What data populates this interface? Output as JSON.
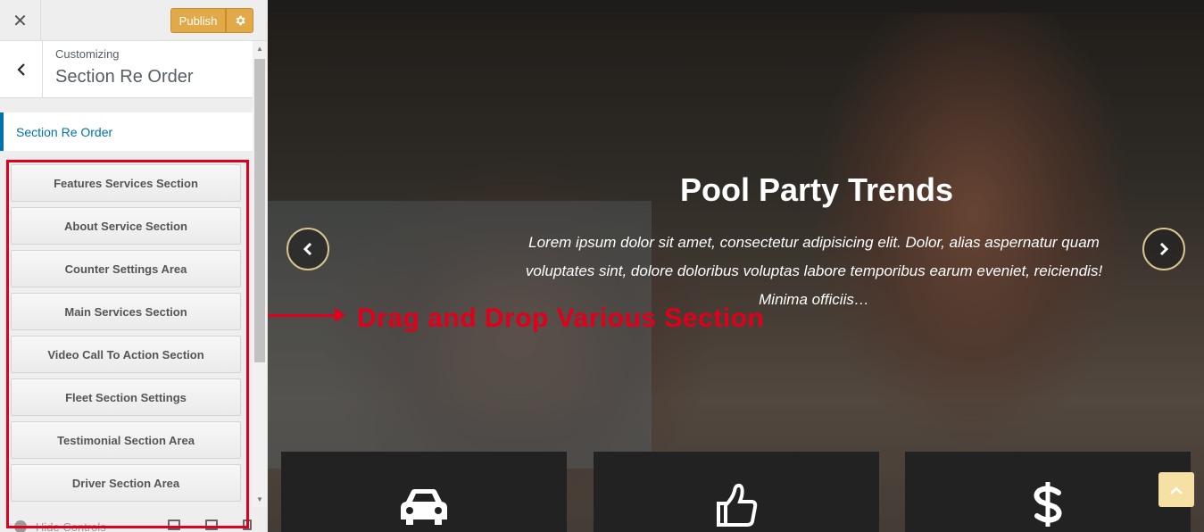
{
  "topbar": {
    "close_label": "✕",
    "publish_label": "Publish"
  },
  "panel": {
    "customizing_label": "Customizing",
    "title": "Section Re Order",
    "tab_label": "Section Re Order"
  },
  "sections": [
    "Features Services Section",
    "About Service Section",
    "Counter Settings Area",
    "Main Services Section",
    "Video Call To Action Section",
    "Fleet Section Settings",
    "Testimonial Section Area",
    "Driver Section Area"
  ],
  "footer": {
    "hide_controls_label": "Hide Controls"
  },
  "hero": {
    "title": "Pool Party Trends",
    "text": "Lorem ipsum dolor sit amet, consectetur adipisicing elit. Dolor, alias aspernatur quam voluptates sint, dolore doloribus voluptas labore temporibus earum eveniet, reiciendis! Minima officiis…"
  },
  "annotation": {
    "text": "Drag and Drop Various Section"
  },
  "cards": [
    {
      "icon": "car-icon"
    },
    {
      "icon": "thumbs-up-icon"
    },
    {
      "icon": "dollar-icon"
    }
  ],
  "colors": {
    "accent_blue": "#0073aa",
    "publish_orange": "#e1a948",
    "annotation_red": "#e0001b",
    "scrolltop_bg": "#f6e0a3"
  }
}
